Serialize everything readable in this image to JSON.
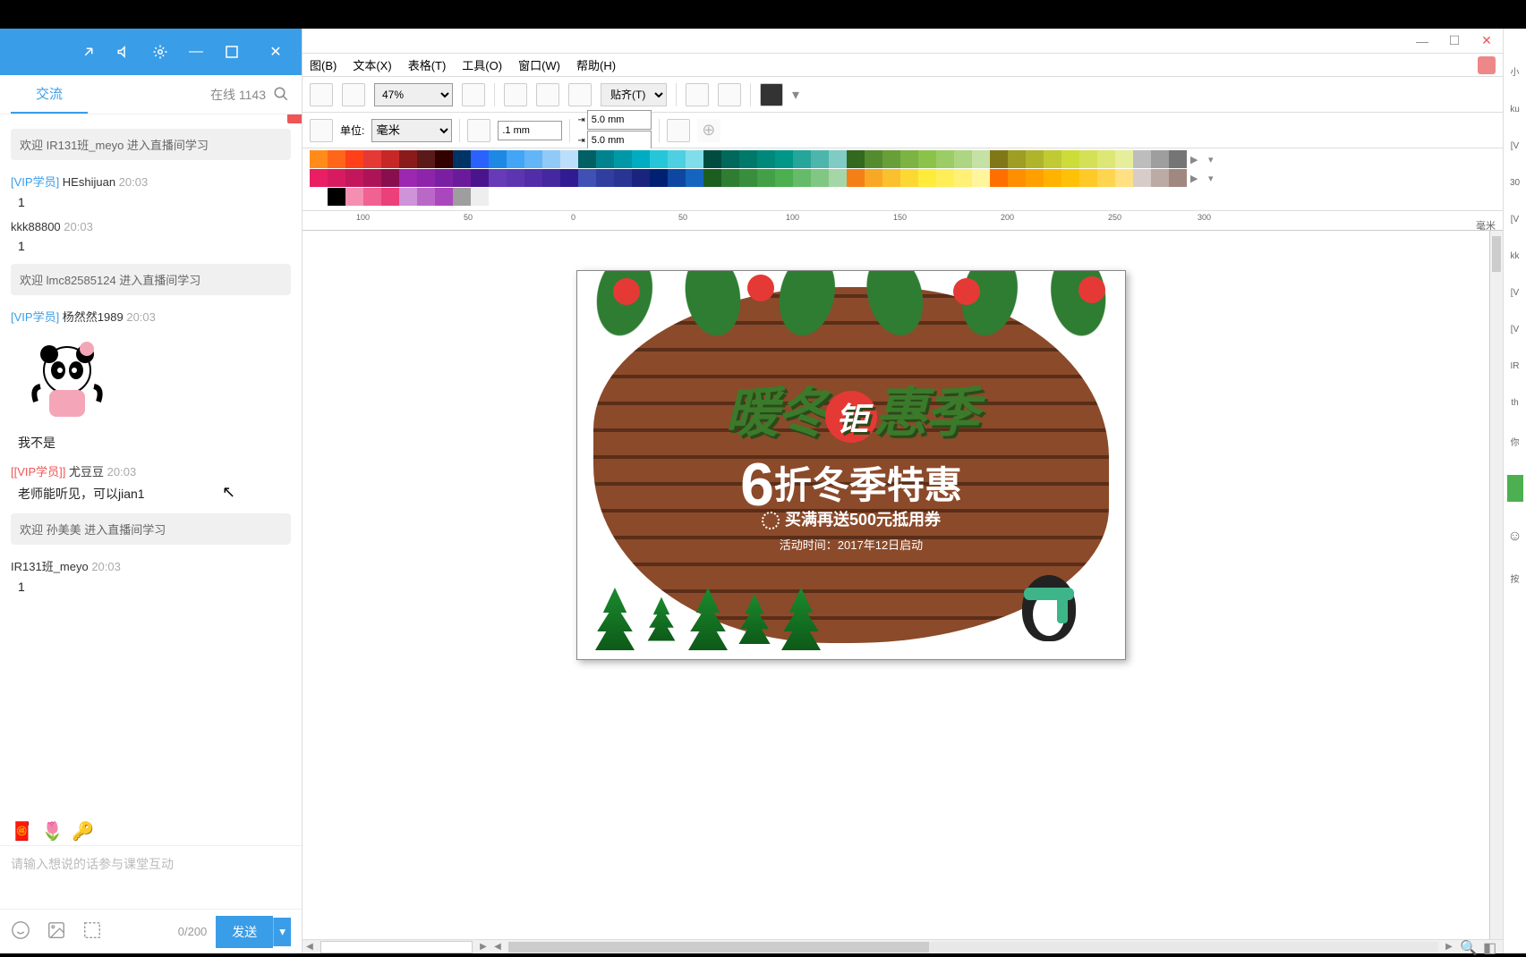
{
  "chat": {
    "tabs": {
      "active": "交流",
      "online_label": "在线 1143"
    },
    "messages": [
      {
        "type": "sys",
        "text": "欢迎 IR131班_meyo 进入直播间学习"
      },
      {
        "type": "msg",
        "tag": "[VIP学员]",
        "tagClass": "vip-tag",
        "user": "HEshijuan",
        "time": "20:03",
        "body": "1"
      },
      {
        "type": "msg",
        "tag": "",
        "tagClass": "",
        "user": "kkk88800",
        "time": "20:03",
        "body": "1"
      },
      {
        "type": "sys",
        "text": "欢迎 lmc82585124 进入直播间学习"
      },
      {
        "type": "msg",
        "tag": "[VIP学员]",
        "tagClass": "vip-tag",
        "user": "杨然然1989",
        "time": "20:03",
        "body": "我不是",
        "sticker": true
      },
      {
        "type": "msg",
        "tag": "[[VIP学员]]",
        "tagClass": "dbl-vip",
        "user": "尤豆豆",
        "time": "20:03",
        "body": "老师能听见，可以jian1"
      },
      {
        "type": "sys",
        "text": "欢迎 孙美美 进入直播间学习"
      },
      {
        "type": "msg",
        "tag": "",
        "tagClass": "",
        "user": "IR131班_meyo",
        "time": "20:03",
        "body": "1"
      }
    ],
    "input_placeholder": "请输入想说的话参与课堂互动",
    "counter": "0/200",
    "send_label": "发送"
  },
  "editor": {
    "menu": {
      "bitmap": "图(B)",
      "text": "文本(X)",
      "table": "表格(T)",
      "tools": "工具(O)",
      "window": "窗口(W)",
      "help": "帮助(H)"
    },
    "toolbar": {
      "zoom": "47%",
      "align": "贴齐(T)"
    },
    "units": {
      "label": "单位:",
      "value": "毫米",
      "step": ".1 mm",
      "nudge_x": "5.0 mm",
      "nudge_y": "5.0 mm"
    },
    "ruler": {
      "ticks": [
        "100",
        "50",
        "0",
        "50",
        "100",
        "150",
        "200",
        "250",
        "300"
      ],
      "unit": "毫米"
    },
    "art": {
      "headline_a": "暖冬",
      "headline_badge": "钜",
      "headline_b": "惠季",
      "subline_num": "6",
      "subline": "折冬季特惠",
      "promo": "买满再送500元抵用券",
      "dates": "活动时间：2017年12日启动"
    }
  },
  "right": {
    "items": [
      "小",
      "ku",
      "[V",
      "30",
      "[V",
      "kk",
      "[V",
      "[V",
      "IR",
      "th",
      "你"
    ],
    "footer": "按"
  }
}
